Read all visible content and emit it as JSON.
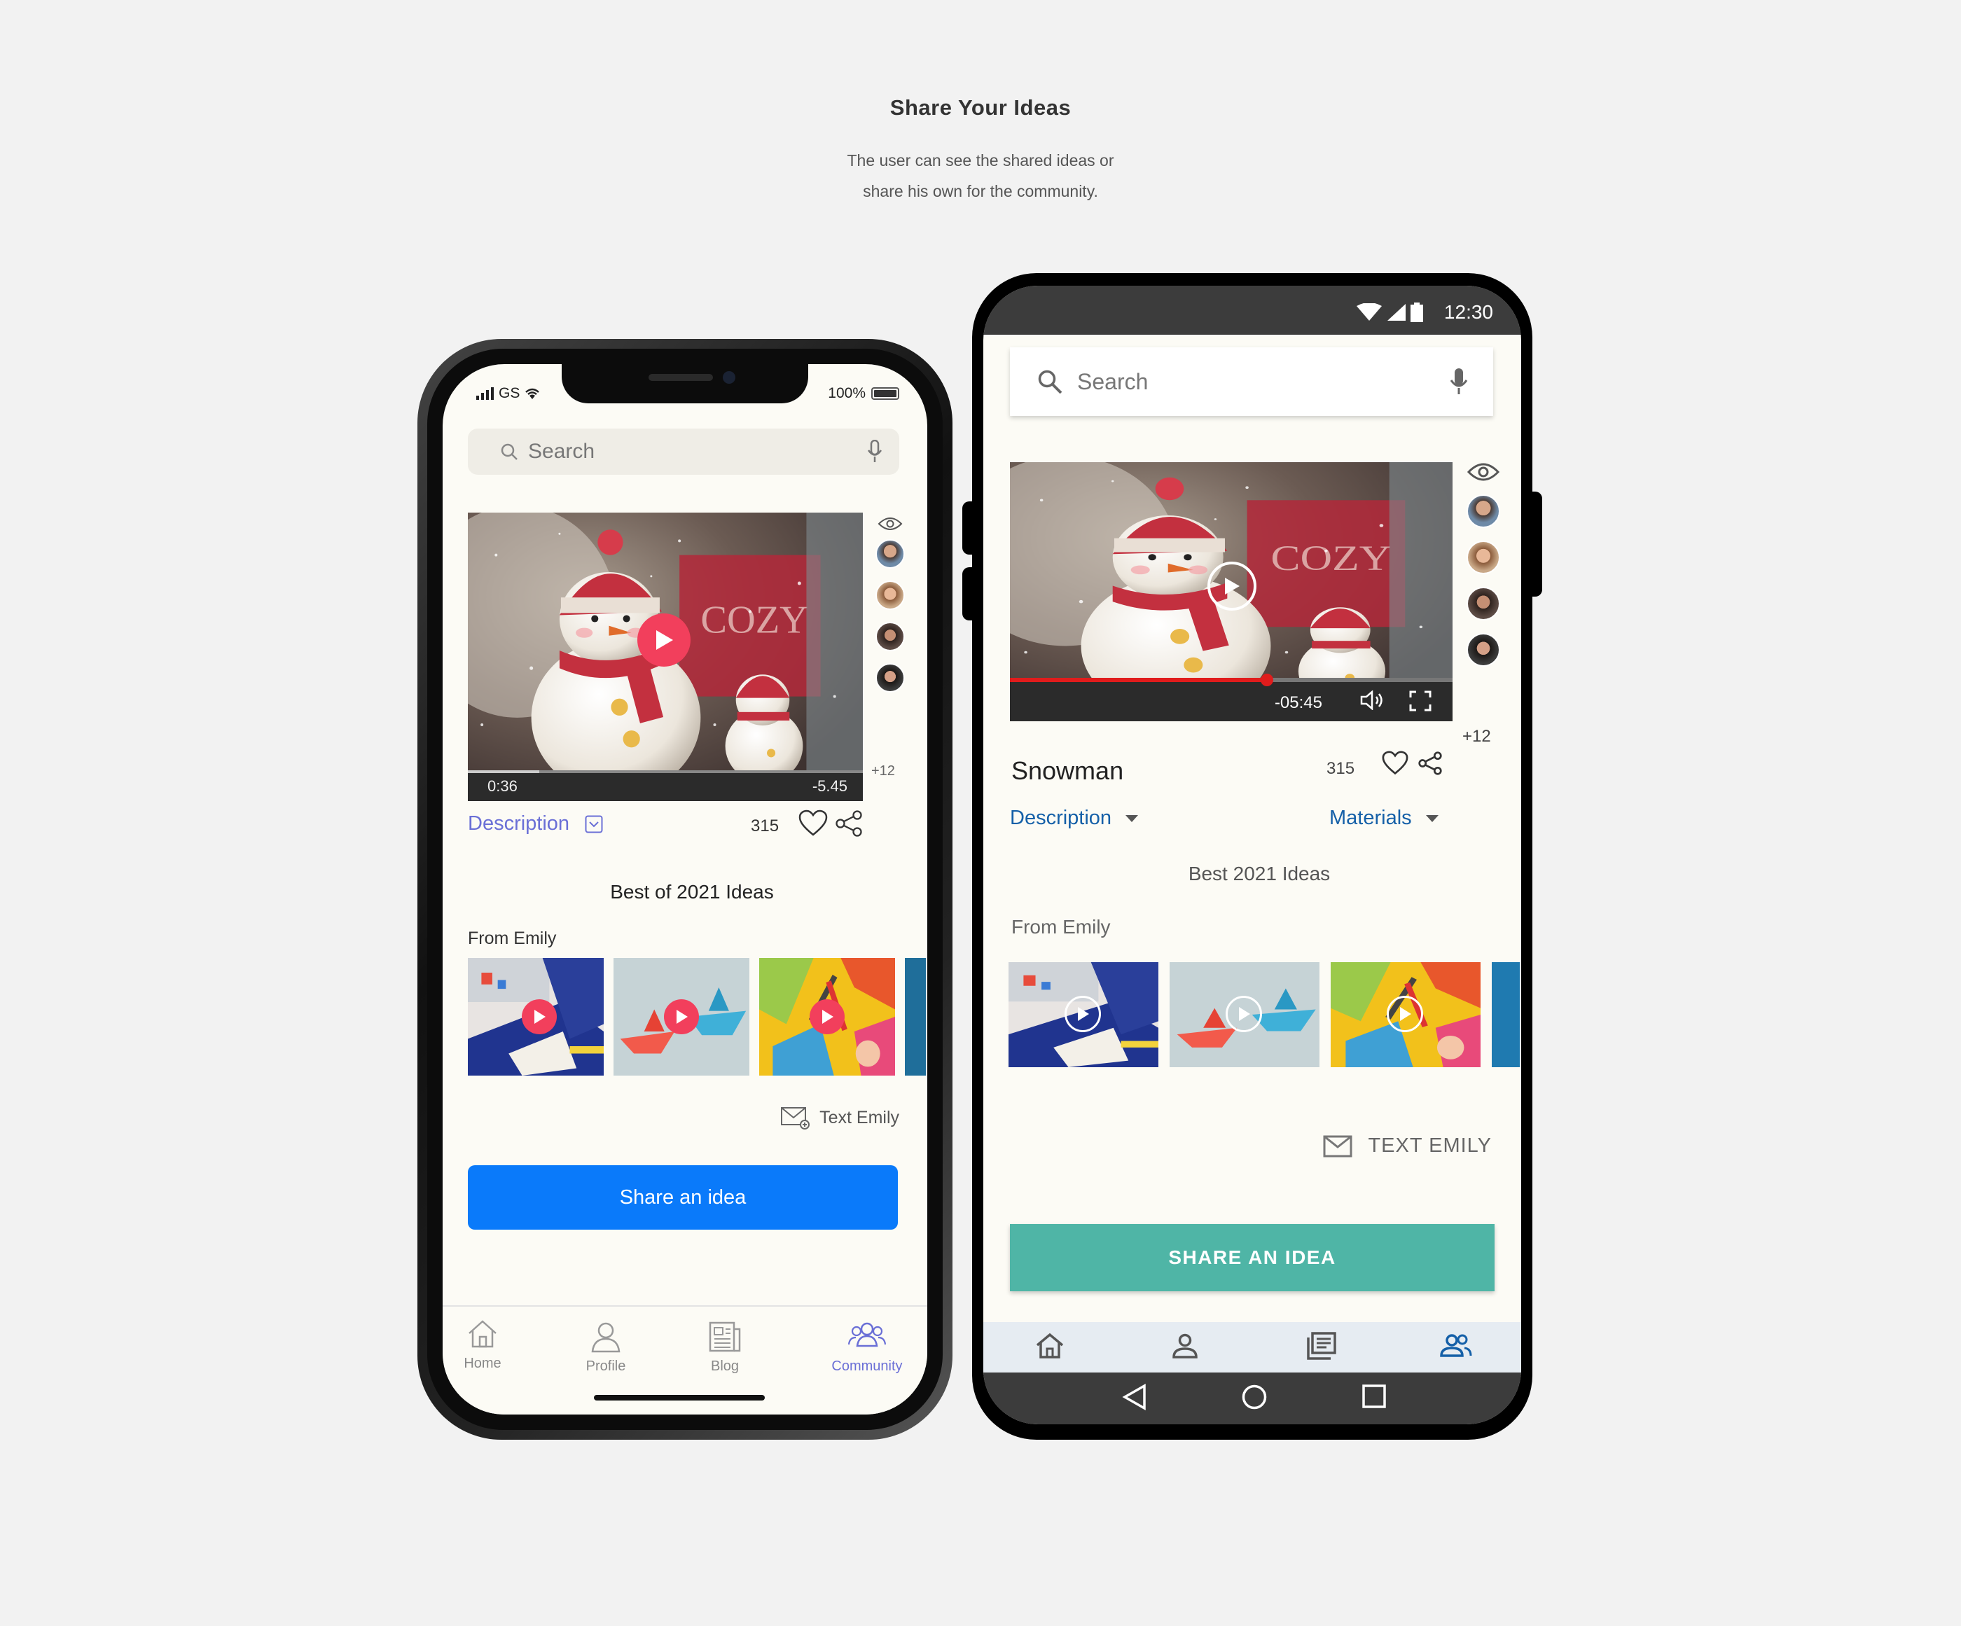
{
  "header": {
    "title": "Share Your Ideas",
    "subtitle_line1": "The user can see the shared ideas or",
    "subtitle_line2": "share his own for the community."
  },
  "ios": {
    "status": {
      "carrier": "GS",
      "battery": "100%"
    },
    "search": {
      "placeholder": "Search"
    },
    "video": {
      "elapsed": "0:36",
      "remaining": "-5.45",
      "progress": 0.18
    },
    "viewers_more": "+12",
    "description_label": "Description",
    "like_count": "315",
    "section_title": "Best of 2021 Ideas",
    "from_label": "From Emily",
    "text_label": "Text Emily",
    "share_button": "Share an idea",
    "tabs": [
      {
        "label": "Home",
        "icon": "home-icon"
      },
      {
        "label": "Profile",
        "icon": "profile-icon"
      },
      {
        "label": "Blog",
        "icon": "blog-icon"
      },
      {
        "label": "Community",
        "icon": "community-icon",
        "active": true
      }
    ],
    "accent_color": "#0a7afa"
  },
  "android": {
    "status": {
      "time": "12:30"
    },
    "search": {
      "placeholder": "Search"
    },
    "video": {
      "remaining": "-05:45",
      "progress": 0.58
    },
    "viewers_more": "+12",
    "title": "Snowman",
    "like_count": "315",
    "description_label": "Description",
    "materials_label": "Materials",
    "section_title": "Best 2021 Ideas",
    "from_label": "From Emily",
    "text_label": "TEXT EMILY",
    "share_button": "SHARE AN IDEA",
    "accent_color": "#4fb5a6"
  }
}
